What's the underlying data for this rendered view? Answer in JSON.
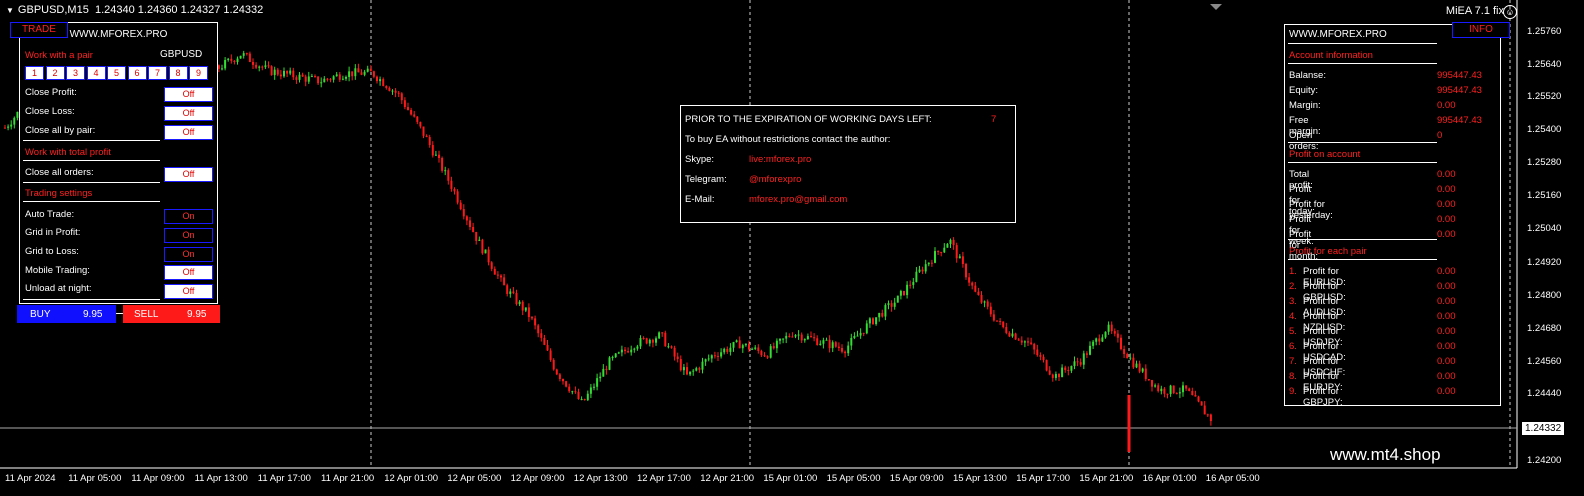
{
  "header": {
    "symbol": "GBPUSD,M15",
    "prices": "1.24340 1.24360 1.24327 1.24332"
  },
  "ea_name": "MiEA 7.1 fix",
  "watermark": "www.mt4.shop",
  "current_price": "1.24332",
  "colors": {
    "bull": "#33dd33",
    "bear": "#ff1a1a",
    "accent": "#ff2020",
    "buy": "#1010ff",
    "sell": "#ff1a1a"
  },
  "left_panel": {
    "tab_label": "TRADE",
    "site": "WWW.MFOREX.PRO",
    "pair_section": "Work with a pair",
    "pair": "GBPUSD",
    "numbers": [
      "1",
      "2",
      "3",
      "4",
      "5",
      "6",
      "7",
      "8",
      "9"
    ],
    "rows": [
      {
        "label": "Close Profit:",
        "value": "Off"
      },
      {
        "label": "Close Loss:",
        "value": "Off"
      },
      {
        "label": "Close all by pair:",
        "value": "Off"
      }
    ],
    "total_section": "Work with total profit",
    "close_all": {
      "label": "Close all orders:",
      "value": "Off"
    },
    "settings_section": "Trading settings",
    "settings": [
      {
        "label": "Auto Trade:",
        "value": "On"
      },
      {
        "label": "Grid in Profit:",
        "value": "On"
      },
      {
        "label": "Grid to Loss:",
        "value": "On"
      },
      {
        "label": "Mobile Trading:",
        "value": "Off"
      },
      {
        "label": "Unload at night:",
        "value": "Off"
      }
    ],
    "buy": {
      "label": "BUY",
      "value": "9.95"
    },
    "sell": {
      "label": "SELL",
      "value": "9.95"
    }
  },
  "message": {
    "title": "PRIOR TO THE EXPIRATION OF WORKING DAYS LEFT:",
    "days": "7",
    "line": "To buy EA without restrictions contact the author:",
    "contacts": [
      {
        "label": "Skype:",
        "value": "live:mforex.pro"
      },
      {
        "label": "Telegram:",
        "value": "@mforexpro"
      },
      {
        "label": "E-Mail:",
        "value": "mforex.pro@gmail.com"
      }
    ]
  },
  "right_panel": {
    "tab_label": "INFO",
    "site": "WWW.MFOREX.PRO",
    "account_section": "Account information",
    "account": [
      {
        "label": "Balanse:",
        "value": "995447.43"
      },
      {
        "label": "Equity:",
        "value": "995447.43"
      },
      {
        "label": "Margin:",
        "value": "0.00"
      },
      {
        "label": "Free margin:",
        "value": "995447.43"
      },
      {
        "label": "Open orders:",
        "value": "0"
      }
    ],
    "profit_section": "Profit on account",
    "profit": [
      {
        "label": "Total profit:",
        "value": "0.00"
      },
      {
        "label": "Profit for today:",
        "value": "0.00"
      },
      {
        "label": "Profit for yesterday:",
        "value": "0.00"
      },
      {
        "label": "Profit for week:",
        "value": "0.00"
      },
      {
        "label": "Profit for month:",
        "value": "0.00"
      }
    ],
    "pair_section": "Profit for each pair",
    "pairs": [
      {
        "n": "1.",
        "label": "Profit for EURUSD:",
        "value": "0.00"
      },
      {
        "n": "2.",
        "label": "Profit for GBPUSD:",
        "value": "0.00"
      },
      {
        "n": "3.",
        "label": "Profit for AUDUSD:",
        "value": "0.00"
      },
      {
        "n": "4.",
        "label": "Profit for NZDUSD:",
        "value": "0.00"
      },
      {
        "n": "5.",
        "label": "Profit for USDJPY:",
        "value": "0.00"
      },
      {
        "n": "6.",
        "label": "Profit for USDCAD:",
        "value": "0.00"
      },
      {
        "n": "7.",
        "label": "Profit for USDCHF:",
        "value": "0.00"
      },
      {
        "n": "8.",
        "label": "Profit for EURJPY:",
        "value": "0.00"
      },
      {
        "n": "9.",
        "label": "Profit for GBPJPY:",
        "value": "0.00"
      }
    ]
  },
  "chart_data": {
    "type": "candlestick",
    "y_ticks": [
      "1.25760",
      "1.25640",
      "1.25520",
      "1.25400",
      "1.25280",
      "1.25160",
      "1.25040",
      "1.24920",
      "1.24800",
      "1.24680",
      "1.24560",
      "1.24440",
      "1.24200"
    ],
    "x_ticks": [
      "11 Apr 2024",
      "11 Apr 05:00",
      "11 Apr 09:00",
      "11 Apr 13:00",
      "11 Apr 17:00",
      "11 Apr 21:00",
      "12 Apr 01:00",
      "12 Apr 05:00",
      "12 Apr 09:00",
      "12 Apr 13:00",
      "12 Apr 17:00",
      "12 Apr 21:00",
      "15 Apr 01:00",
      "15 Apr 05:00",
      "15 Apr 09:00",
      "15 Apr 13:00",
      "15 Apr 17:00",
      "15 Apr 21:00",
      "16 Apr 01:00",
      "16 Apr 05:00"
    ],
    "close_path": [
      1.2541,
      1.2552,
      1.2573,
      1.2558,
      1.2543,
      1.252,
      1.251,
      1.2538,
      1.2562,
      1.2568,
      1.2562,
      1.256,
      1.2558,
      1.2561,
      1.2561,
      1.2553,
      1.2538,
      1.252,
      1.25,
      1.2483,
      1.2472,
      1.2452,
      1.244,
      1.2455,
      1.2462,
      1.2465,
      1.245,
      1.2458,
      1.2462,
      1.2458,
      1.2466,
      1.2463,
      1.246,
      1.247,
      1.2478,
      1.249,
      1.25,
      1.248,
      1.2468,
      1.2462,
      1.245,
      1.2456,
      1.2468,
      1.2455,
      1.2445,
      1.2445,
      1.2434
    ]
  }
}
